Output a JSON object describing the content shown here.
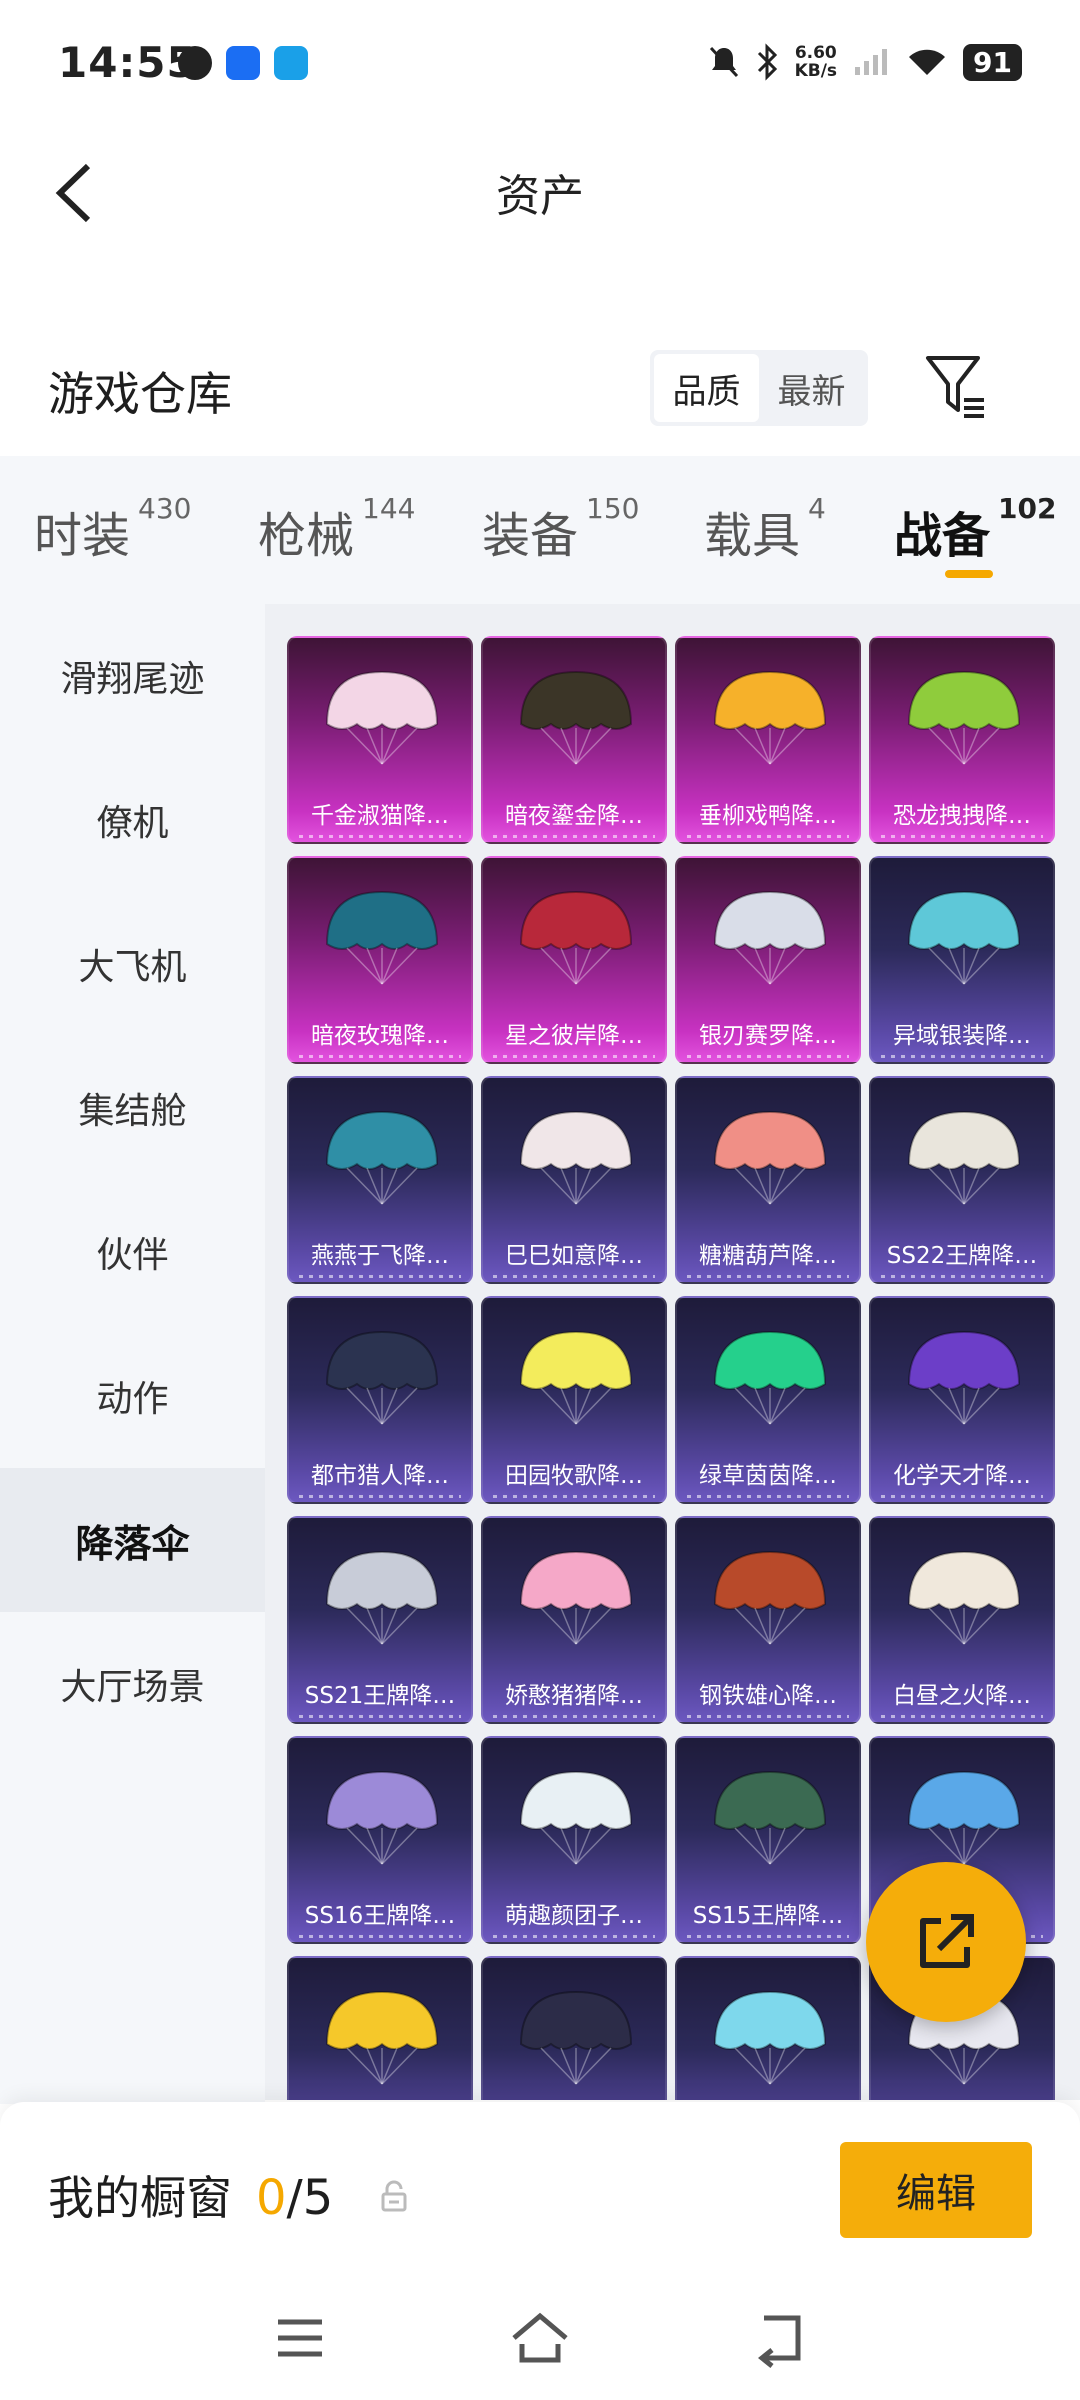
{
  "status": {
    "time": "14:55",
    "net_speed_value": "6.60",
    "net_speed_unit": "KB/s",
    "battery": "91"
  },
  "header": {
    "title": "资产"
  },
  "warehouse": {
    "title": "游戏仓库",
    "sort_options": [
      "品质",
      "最新"
    ]
  },
  "tabs": [
    {
      "label": "时装",
      "count": "430"
    },
    {
      "label": "枪械",
      "count": "144"
    },
    {
      "label": "装备",
      "count": "150"
    },
    {
      "label": "载具",
      "count": "4"
    },
    {
      "label": "战备",
      "count": "102"
    }
  ],
  "sidebar": [
    {
      "label": "滑翔尾迹"
    },
    {
      "label": "僚机"
    },
    {
      "label": "大飞机"
    },
    {
      "label": "集结舱"
    },
    {
      "label": "伙伴"
    },
    {
      "label": "动作"
    },
    {
      "label": "降落伞"
    },
    {
      "label": "大厅场景"
    }
  ],
  "items": [
    {
      "label": "千金淑猫降…",
      "tier": "purple",
      "color": "#f3d6e6"
    },
    {
      "label": "暗夜鎏金降…",
      "tier": "purple",
      "color": "#3b3527"
    },
    {
      "label": "垂柳戏鸭降…",
      "tier": "purple",
      "color": "#f6b12a"
    },
    {
      "label": "恐龙拽拽降…",
      "tier": "purple",
      "color": "#8fcc3c"
    },
    {
      "label": "暗夜玫瑰降…",
      "tier": "purple",
      "color": "#1f6f86"
    },
    {
      "label": "星之彼岸降…",
      "tier": "purple",
      "color": "#b8283a"
    },
    {
      "label": "银刃赛罗降…",
      "tier": "purple",
      "color": "#d9dde8"
    },
    {
      "label": "异域银装降…",
      "tier": "blue",
      "color": "#5ec8d8"
    },
    {
      "label": "燕燕于飞降…",
      "tier": "blue",
      "color": "#2f8fa6"
    },
    {
      "label": "巳巳如意降…",
      "tier": "blue",
      "color": "#f0e6e8"
    },
    {
      "label": "糖糖葫芦降…",
      "tier": "blue",
      "color": "#f08f86"
    },
    {
      "label": "SS22王牌降…",
      "tier": "blue",
      "color": "#e9e5dc"
    },
    {
      "label": "都市猎人降…",
      "tier": "blue",
      "color": "#2b3350"
    },
    {
      "label": "田园牧歌降…",
      "tier": "blue",
      "color": "#f3ec5c"
    },
    {
      "label": "绿草茵茵降…",
      "tier": "blue",
      "color": "#25d08c"
    },
    {
      "label": "化学天才降…",
      "tier": "blue",
      "color": "#6c3ec8"
    },
    {
      "label": "SS21王牌降…",
      "tier": "blue",
      "color": "#c8ccd8"
    },
    {
      "label": "娇憨猪猪降…",
      "tier": "blue",
      "color": "#f5a8c8"
    },
    {
      "label": "钢铁雄心降…",
      "tier": "blue",
      "color": "#b84a2a"
    },
    {
      "label": "白昼之火降…",
      "tier": "blue",
      "color": "#f0e8dc"
    },
    {
      "label": "SS16王牌降…",
      "tier": "blue",
      "color": "#9c8ad8"
    },
    {
      "label": "萌趣颜团子…",
      "tier": "blue",
      "color": "#e8f0f4"
    },
    {
      "label": "SS15王牌降…",
      "tier": "blue",
      "color": "#3b6a52"
    },
    {
      "label": "",
      "tier": "blue",
      "color": "#5aa8e8"
    },
    {
      "label": "",
      "tier": "blue",
      "color": "#f5c82a"
    },
    {
      "label": "",
      "tier": "blue",
      "color": "#2c2c48"
    },
    {
      "label": "",
      "tier": "blue",
      "color": "#7ed8ec"
    },
    {
      "label": "",
      "tier": "blue",
      "color": "#e8e8f0"
    }
  ],
  "showcase": {
    "title": "我的橱窗",
    "current": "0",
    "total": "/5",
    "edit_label": "编辑"
  },
  "colors": {
    "accent": "#f5ad0a",
    "purple_tier": "#c832c2",
    "blue_tier": "#5a49a6"
  }
}
